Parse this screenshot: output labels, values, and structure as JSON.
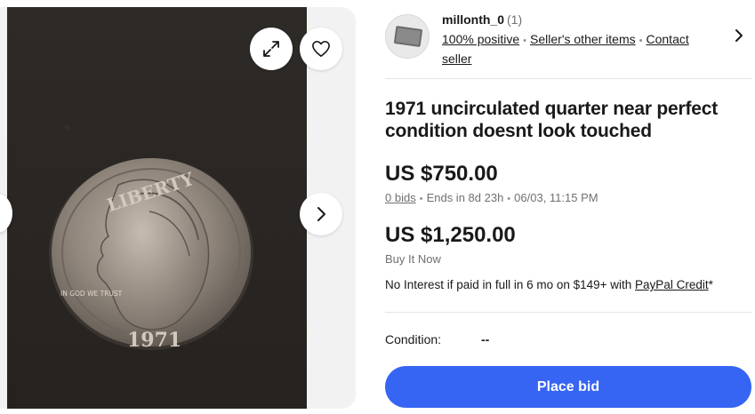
{
  "seller": {
    "name": "millonth_0",
    "feedback_count": "(1)",
    "positive": "100% positive",
    "other_items": "Seller's other items",
    "contact": "Contact seller"
  },
  "listing": {
    "title": "1971 uncirculated quarter near perfect condition doesnt look touched",
    "bid_price": "US $750.00",
    "bids": "0 bids",
    "ends": "Ends in 8d 23h",
    "end_date": "06/03, 11:15 PM",
    "buy_price": "US $1,250.00",
    "buy_label": "Buy It Now",
    "credit_text": "No Interest if paid in full in 6 mo on $149+ with ",
    "credit_link": "PayPal Credit",
    "credit_suffix": "*",
    "condition_label": "Condition:",
    "condition_value": "--"
  },
  "actions": {
    "place_bid": "Place bid"
  },
  "photo": {
    "coin_inscriptions": [
      "LIBERTY",
      "IN GOD WE TRUST",
      "1971"
    ]
  },
  "icons": {
    "expand": "expand-icon",
    "heart": "heart-icon",
    "next": "chevron-right-icon",
    "seller_chevron": "chevron-right-icon"
  },
  "colors": {
    "primary_button": "#3665f3",
    "text": "#191919",
    "muted": "#707070"
  }
}
